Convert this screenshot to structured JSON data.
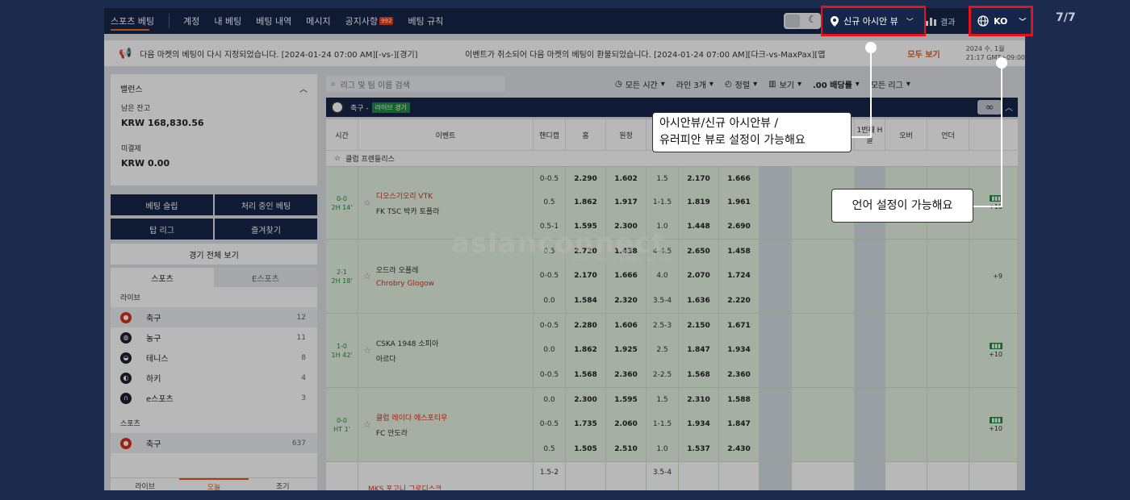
{
  "nav": {
    "brand": "스포츠 베팅",
    "items": [
      "계정",
      "내 베팅",
      "베팅 내역",
      "메시지",
      "공지사항",
      "베팅 규칙"
    ],
    "notice_badge": "992",
    "view_select": "신규 아시안 뷰",
    "results": "결과",
    "language": "KO"
  },
  "ticker": {
    "msg1": "다음 마켓의 베팅이 다시 지정되었습니다. [2024-01-24 07:00 AM][-vs-][경기]",
    "msg2": "이벤트가 취소되어 다음 마켓의 베팅이 환불되었습니다. [2024-01-24 07:00 AM][다크-vs-MaxPax][맵",
    "all_view": "모두 보기",
    "date": "2024 수, 1월",
    "time": "21:17 GMT+09:00"
  },
  "balance": {
    "title": "밸런스",
    "remain_label": "남은 잔고",
    "remain_value": "KRW 168,830.56",
    "unsettled_label": "미결제",
    "unsettled_value": "KRW 0.00"
  },
  "left_buttons": [
    "베팅 슬립",
    "처리 중인 베팅",
    "탑 리그",
    "즐겨찾기"
  ],
  "full_view": "경기 전체 보기",
  "sports_tabs": [
    "스포츠",
    "E스포츠"
  ],
  "live_label": "라이브",
  "live_sports": [
    {
      "name": "축구",
      "count": "12",
      "color": "#d9301b"
    },
    {
      "name": "농구",
      "count": "11",
      "color": "#1c2233"
    },
    {
      "name": "테니스",
      "count": "8",
      "color": "#1c2233"
    },
    {
      "name": "하키",
      "count": "4",
      "color": "#1c2233"
    },
    {
      "name": "e스포츠",
      "count": "3",
      "color": "#1c2233"
    }
  ],
  "sports_label": "스포츠",
  "sports": [
    {
      "name": "축구",
      "count": "637",
      "color": "#d9301b"
    }
  ],
  "bottom_tabs": [
    "라이브",
    "오늘",
    "조기"
  ],
  "filters": {
    "search_placeholder": "리그 및 팀 이름 검색",
    "items": [
      "모든 시간",
      "라인 3개",
      "정렬",
      "보기",
      ".00 배당률",
      "모든 리그"
    ]
  },
  "league_header": {
    "sport": "축구 -",
    "live": "라이브 경기",
    "infinity": "∞"
  },
  "columns": [
    "시간",
    "이벤트",
    "핸디캡",
    "홈",
    "원정",
    "",
    "",
    "",
    "",
    "",
    "1번째 H 골",
    "오버",
    "언더",
    ""
  ],
  "league_name": "클럽 프렌들리스",
  "matches": [
    {
      "score": "0-0",
      "clock": "2H 14'",
      "home": "디오스기오리 VTK",
      "away": "FK TSC 박카 토폴라",
      "hc": [
        "0-0.5",
        "0.5",
        "0.5-1"
      ],
      "h": [
        "2.290",
        "1.862",
        "1.595"
      ],
      "a": [
        "1.602",
        "1.917",
        "2.300"
      ],
      "ou": [
        "1.5",
        "1-1.5",
        "1.0"
      ],
      "o": [
        "2.170",
        "1.819",
        "1.448"
      ],
      "u": [
        "1.666",
        "1.961",
        "2.690"
      ],
      "more": "+10"
    },
    {
      "score": "2-1",
      "clock": "2H 18'",
      "home": "오드라 오폴레",
      "away": "Chrobry Glogow",
      "hc": [
        "0.5",
        "0-0.5",
        "0.0"
      ],
      "h": [
        "2.720",
        "2.170",
        "1.584"
      ],
      "a": [
        "1.438",
        "1.666",
        "2.320"
      ],
      "ou": [
        "4-4.5",
        "4.0",
        "3.5-4"
      ],
      "o": [
        "2.650",
        "2.070",
        "1.636"
      ],
      "u": [
        "1.458",
        "1.724",
        "2.220"
      ],
      "more": "+9"
    },
    {
      "score": "1-0",
      "clock": "1H 42'",
      "home": "CSKA 1948 소피아",
      "away": "아르다",
      "hc": [
        "0-0.5",
        "0.0",
        "0-0.5"
      ],
      "h": [
        "2.280",
        "1.862",
        "1.568"
      ],
      "a": [
        "1.606",
        "1.925",
        "2.360"
      ],
      "ou": [
        "2.5-3",
        "2.5",
        "2-2.5"
      ],
      "o": [
        "2.150",
        "1.847",
        "1.568"
      ],
      "u": [
        "1.671",
        "1.934",
        "2.360"
      ],
      "more": "+10"
    },
    {
      "score": "0-0",
      "clock": "HT 1'",
      "home": "클럽 레이다 에스포티우",
      "away": "FC 안도라",
      "hc": [
        "0.0",
        "0-0.5",
        "0.5"
      ],
      "h": [
        "2.300",
        "1.735",
        "1.505"
      ],
      "a": [
        "1.595",
        "2.060",
        "2.510"
      ],
      "ou": [
        "1.5",
        "1-1.5",
        "1.0"
      ],
      "o": [
        "2.310",
        "1.934",
        "1.537"
      ],
      "u": [
        "1.588",
        "1.847",
        "2.430"
      ],
      "more": "+10"
    },
    {
      "score": "",
      "clock": "",
      "home": "MKS 포고니 그로디스크",
      "away": "",
      "hc": [
        "1.5-2",
        "",
        ""
      ],
      "h": [
        "",
        "",
        ""
      ],
      "a": [
        "",
        "",
        ""
      ],
      "ou": [
        "3.5-4",
        "",
        ""
      ],
      "o": [
        "",
        "",
        ""
      ],
      "u": [
        "",
        "",
        ""
      ],
      "more": ""
    }
  ],
  "watermark": {
    "brand": "asianconnect",
    "tagline": "LET THE GAMES BEGIN"
  },
  "callouts": {
    "view": [
      "아시안뷰/신규 아시안뷰 /",
      "유러피안 뷰로 설정이 가능해요"
    ],
    "lang": "언어 설정이 가능해요"
  },
  "page_indicator": "7/7"
}
